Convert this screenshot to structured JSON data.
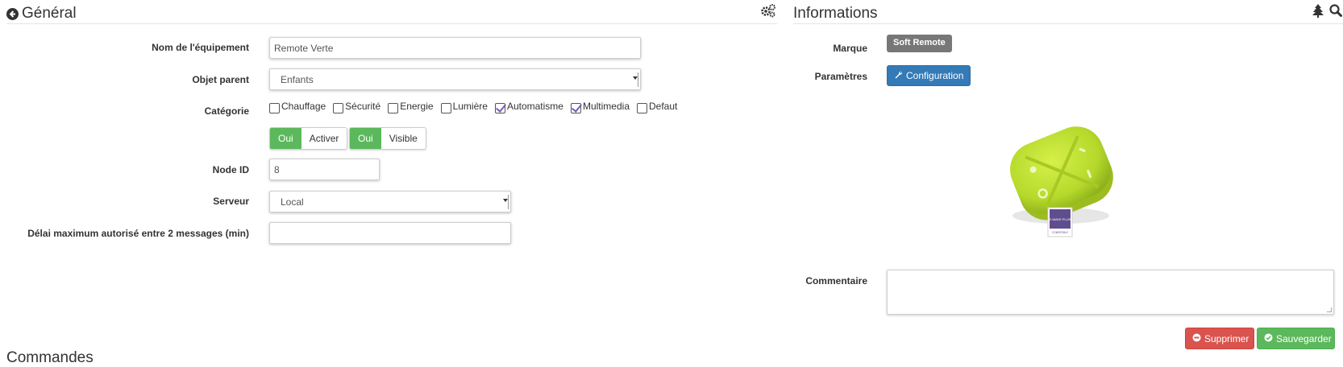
{
  "general": {
    "title": "Général"
  },
  "informations": {
    "title": "Informations",
    "marque_label": "Marque",
    "marque_value": "Soft Remote",
    "parametres_label": "Paramètres",
    "configuration_button": "Configuration",
    "commentaire_label": "Commentaire",
    "commentaire_value": ""
  },
  "form": {
    "nom_label": "Nom de l'équipement",
    "nom_value": "Remote Verte",
    "objet_label": "Objet parent",
    "objet_value": "Enfants",
    "categorie_label": "Catégorie",
    "categories": [
      {
        "label": "Chauffage",
        "checked": false
      },
      {
        "label": "Sécurité",
        "checked": false
      },
      {
        "label": "Energie",
        "checked": false
      },
      {
        "label": "Lumière",
        "checked": false
      },
      {
        "label": "Automatisme",
        "checked": true
      },
      {
        "label": "Multimedia",
        "checked": true
      },
      {
        "label": "Defaut",
        "checked": false
      }
    ],
    "activer_on": "Oui",
    "activer_label": "Activer",
    "visible_on": "Oui",
    "visible_label": "Visible",
    "node_label": "Node ID",
    "node_value": "8",
    "serveur_label": "Serveur",
    "serveur_value": "Local",
    "delai_label": "Délai maximum autorisé entre 2 messages (min)",
    "delai_value": ""
  },
  "actions": {
    "supprimer": "Supprimer",
    "sauvegarder": "Sauvegarder"
  },
  "commandes": {
    "title": "Commandes"
  },
  "device_image": {
    "badge_line1": "Z-WAVE PLUS",
    "badge_line2": "COMPATIBLE"
  },
  "colors": {
    "primary": "#337ab7",
    "success": "#5cb85c",
    "danger": "#d9534f",
    "badge": "#777777",
    "device_green": "#b5d92b"
  },
  "icons": {
    "general": "circle-arrow-left-icon",
    "gears": "gears-icon",
    "tree": "tree-icon",
    "search": "search-icon",
    "wrench": "wrench-icon",
    "minus_circle": "minus-circle-icon",
    "check_circle": "check-circle-icon"
  }
}
